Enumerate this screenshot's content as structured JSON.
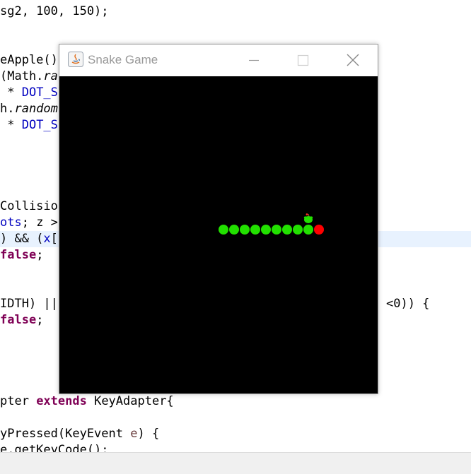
{
  "code": {
    "lines": [
      {
        "id": "l1",
        "segments": [
          {
            "t": "sg2, 100, 150);",
            "c": ""
          }
        ]
      },
      {
        "id": "l2",
        "segments": [
          {
            "t": "eApple()",
            "c": ""
          }
        ]
      },
      {
        "id": "l3",
        "segments": [
          {
            "t": "(Math.",
            "c": ""
          },
          {
            "t": "ra",
            "c": "it"
          }
        ]
      },
      {
        "id": "l4",
        "segments": [
          {
            "t": " * ",
            "c": ""
          },
          {
            "t": "DOT_S",
            "c": "fld"
          }
        ]
      },
      {
        "id": "l5",
        "segments": [
          {
            "t": "h.",
            "c": ""
          },
          {
            "t": "random",
            "c": "it"
          }
        ]
      },
      {
        "id": "l6",
        "segments": [
          {
            "t": " * ",
            "c": ""
          },
          {
            "t": "DOT_S",
            "c": "fld"
          }
        ]
      },
      {
        "id": "l7",
        "segments": [
          {
            "t": "Collisio",
            "c": ""
          }
        ]
      },
      {
        "id": "l8",
        "segments": [
          {
            "t": "ots",
            "c": "fld"
          },
          {
            "t": "; z >",
            "c": ""
          }
        ]
      },
      {
        "id": "l9",
        "segments": [
          {
            "t": ") && (",
            "c": ""
          },
          {
            "t": "x",
            "c": "fld"
          },
          {
            "t": "[",
            "c": ""
          }
        ]
      },
      {
        "id": "l10",
        "segments": [
          {
            "t": "false",
            "c": "kw"
          },
          {
            "t": ";",
            "c": ""
          }
        ]
      },
      {
        "id": "l11",
        "segments": [
          {
            "t": "IDTH) ||",
            "c": ""
          }
        ]
      },
      {
        "id": "l12",
        "segments": [
          {
            "t": "false",
            "c": "kw"
          },
          {
            "t": ";",
            "c": ""
          }
        ]
      },
      {
        "id": "l13",
        "segments": [
          {
            "t": "pter ",
            "c": ""
          },
          {
            "t": "extends",
            "c": "kw"
          },
          {
            "t": " KeyAdapter{",
            "c": ""
          }
        ]
      },
      {
        "id": "l14",
        "segments": [
          {
            "t": "yPressed(KeyEvent ",
            "c": ""
          },
          {
            "t": "e",
            "c": "pm"
          },
          {
            "t": ") {",
            "c": ""
          }
        ]
      },
      {
        "id": "l15",
        "segments": [
          {
            "t": "e.getKeyCode();",
            "c": ""
          }
        ]
      }
    ],
    "right_fragment": "<0)) {"
  },
  "window": {
    "title": "Snake Game",
    "minimize": "—",
    "maximize": "☐",
    "close": "✕"
  },
  "game": {
    "snake_color": "#22e000",
    "head_color": "#ff0000",
    "background": "#000000",
    "body_segments": 9,
    "apple": "apple-icon"
  }
}
